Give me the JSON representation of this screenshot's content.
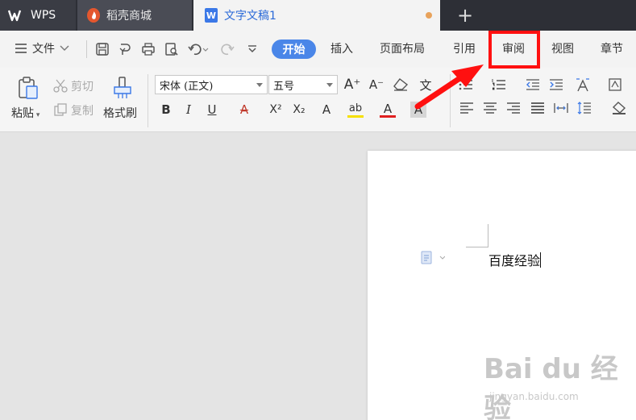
{
  "tabs": {
    "app_label": "WPS",
    "store_label": "稻壳商城",
    "doc_label": "文字文稿1",
    "new_tab": "+"
  },
  "menu": {
    "file": "文件",
    "start": "开始",
    "insert": "插入",
    "layout": "页面布局",
    "reference": "引用",
    "review": "审阅",
    "view": "视图",
    "chapter": "章节"
  },
  "ribbon": {
    "paste": "粘贴",
    "cut": "剪切",
    "copy": "复制",
    "format_painter": "格式刷",
    "font_name": "宋体 (正文)",
    "font_size": "五号",
    "grow_font": "A⁺",
    "shrink_font": "A⁻",
    "bold": "B",
    "italic": "I",
    "underline": "U",
    "strikethrough": "A",
    "superscript": "X²",
    "subscript": "X₂",
    "text_effect": "A",
    "highlight": "ab",
    "font_color": "A",
    "char_shading": "A",
    "phonetic": "文"
  },
  "document": {
    "text": "百度经验"
  },
  "watermark": {
    "main": "Bai du 经验",
    "sub": "jingyan.baidu.com"
  },
  "colors": {
    "tabbar_bg": "#2d2f36",
    "accent_blue": "#4a86e8",
    "annotation_red": "#ff1010"
  }
}
